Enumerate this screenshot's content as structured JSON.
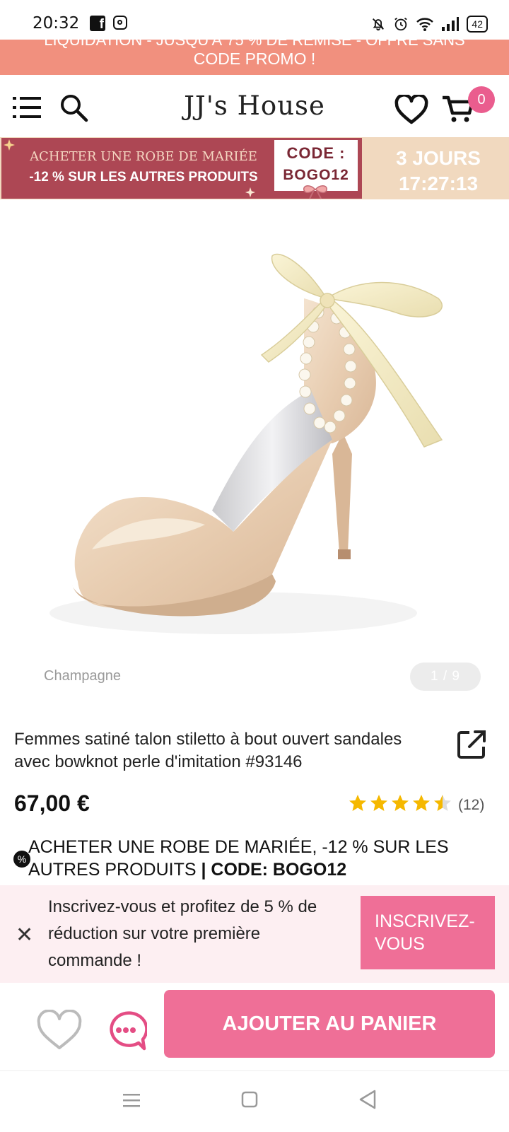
{
  "status_bar": {
    "time": "20:32",
    "battery": "42",
    "icons": [
      "facebook-icon",
      "instagram-icon",
      "mute-icon",
      "alarm-icon",
      "wifi-icon",
      "signal-icon",
      "battery-icon"
    ]
  },
  "promo_bar": {
    "line1": "LIQUIDATION - JUSQU'À 75 % DE REMISE - OFFRE SANS",
    "line2": "CODE PROMO !"
  },
  "header": {
    "logo": "JJ's House",
    "cart_count": "0",
    "icons": [
      "menu-icon",
      "search-icon",
      "heart-icon",
      "cart-icon"
    ]
  },
  "campaign": {
    "line1": "ACHETER UNE ROBE DE MARIÉE",
    "line2": "-12 % SUR LES AUTRES PRODUITS",
    "code_label": "CODE :",
    "code_value": "BOGO12",
    "countdown_days": "3 JOURS",
    "countdown_time": "17:27:13"
  },
  "gallery": {
    "color_name": "Champagne",
    "counter": "1 / 9"
  },
  "product": {
    "title": "Femmes satiné talon stiletto à bout ouvert sandales avec bowknot perle d'imitation #93146",
    "price": "67,00 €",
    "rating": 4.5,
    "rating_count": "(12)",
    "promo_text": "ACHETER UNE ROBE DE MARIÉE, -12 % SUR LES AUTRES PRODUITS ",
    "promo_code": "| CODE: BOGO12"
  },
  "signup": {
    "text": "Inscrivez-vous et profitez de 5 % de réduction sur votre première commande !",
    "button": "INSCRIVEZ-VOUS"
  },
  "actions": {
    "add_to_cart": "AJOUTER AU PANIER"
  },
  "colors": {
    "promo_bar": "#f1907e",
    "campaign_red": "#ad4754",
    "campaign_beige": "#f1d9bf",
    "accent_pink": "#ef6f97",
    "badge_pink": "#ea5d8e",
    "signup_bg": "#fdeff2",
    "star": "#f5b800"
  }
}
